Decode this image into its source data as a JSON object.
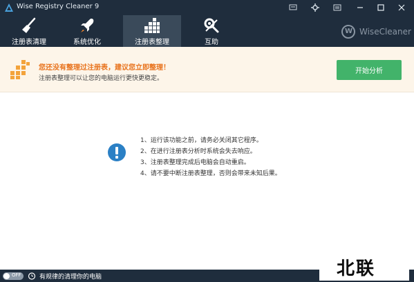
{
  "window": {
    "title": "Wise Registry Cleaner 9"
  },
  "tabs": [
    {
      "label": "注册表清理",
      "icon": "broom-icon"
    },
    {
      "label": "系统优化",
      "icon": "rocket-icon"
    },
    {
      "label": "注册表整理",
      "icon": "blocks-icon",
      "active": true
    },
    {
      "label": "互助",
      "icon": "tools-icon"
    }
  ],
  "brand": {
    "name": "WiseCleaner"
  },
  "banner": {
    "title": "您还没有整理过注册表，建议您立即整理！",
    "subtitle": "注册表整理可以让您的电脑运行更快更稳定。",
    "button_label": "开始分析"
  },
  "notes": [
    "1、运行该功能之前，请务必关闭其它程序。",
    "2、在进行注册表分析时系统会失去响应。",
    "3、注册表整理完成后电脑会自动重启。",
    "4、请不要中断注册表整理，否则会带来未知后果。"
  ],
  "statusbar": {
    "toggle_label": "OFF",
    "text": "有规律的清理你的电脑"
  },
  "watermark": {
    "text": "北联"
  },
  "colors": {
    "header_bg": "#1f2d3d",
    "active_tab": "#3a4a5a",
    "banner_bg": "#fdf5e9",
    "banner_title": "#e8731d",
    "button_green": "#42b36a",
    "info_blue": "#2b80c5"
  }
}
